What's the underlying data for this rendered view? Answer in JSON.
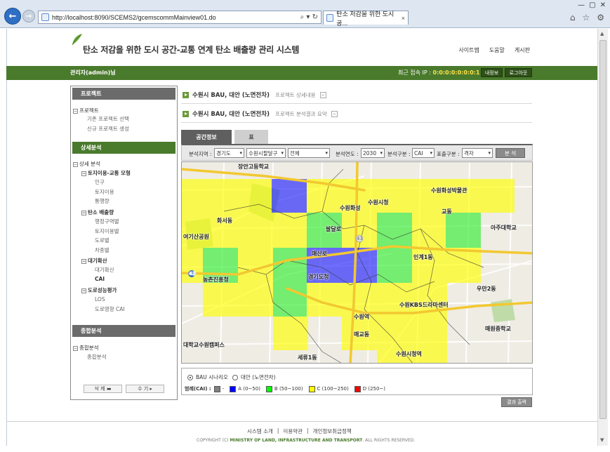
{
  "browser": {
    "url": "http://localhost:8090/SCEMS2/gcemscommMainview01.do",
    "tab_title": "탄소 저감을 위한 도시 공...",
    "tab_close": "×",
    "address_controls": "⌕ ▾ ↻"
  },
  "header": {
    "site_title": "탄소 저감을 위한 도시 공간-교통 연계 탄소 배출량 관리 시스템",
    "links": [
      "사이트맵",
      "도움말",
      "게시판"
    ]
  },
  "userbar": {
    "user": "관리자(admin)님",
    "ip_label": "최근 접속 IP :",
    "ip_value": "0:0:0:0:0:0:0:1",
    "buttons": [
      "내정보",
      "로그아웃"
    ]
  },
  "sidebar": {
    "project_head": "프로젝트",
    "project_items": [
      "프로젝트",
      "기존 프로젝트 선택",
      "신규 프로젝트 생성"
    ],
    "detail_head": "상세분석",
    "detail_items": [
      "상세 분석",
      "토지이용-교통 모형",
      "인구",
      "토지이용",
      "통행량",
      "탄소 배출량",
      "행정구역별",
      "토지이용별",
      "도로별",
      "차종별",
      "대기확산",
      "대기확산",
      "CAI",
      "도로성능평가",
      "LOS",
      "도로영향 CAI"
    ],
    "summary_head": "종합분석",
    "summary_items": [
      "종합분석",
      "종합분석"
    ],
    "btn_delete": "삭 제 ▬",
    "btn_edit": "수 기 ▸"
  },
  "content": {
    "project1_title": "수원시 BAU, 대안 (노면전차)",
    "project1_desc": "프로젝트 상세내용",
    "project2_title": "수원시 BAU, 대안 (노면전차)",
    "project2_desc": "프로젝트 분석결과 요약",
    "tab_spatial": "공간정보",
    "tab_table": "표",
    "filter": {
      "region_label": "분석지역 :",
      "region1": "경기도",
      "region2": "수원시팔달구",
      "region3": "전체",
      "year_label": "분석연도 :",
      "year": "2030",
      "type_label": "분석구분 :",
      "type": "CAI",
      "display_label": "표출구분 :",
      "display": "격자",
      "analyze_btn": "분 석"
    },
    "map_labels": [
      "장안고등학교",
      "수원화성",
      "수원화성박물관",
      "수원시청",
      "아주대학교",
      "교동",
      "우만2동",
      "경기도청",
      "매산로",
      "수원역",
      "매원중학교",
      "세류1동",
      "대학교수원캠퍼스",
      "농촌진흥청",
      "여기산공원",
      "팔달로",
      "인계1동",
      "화서동",
      "매교동",
      "수원KBS드라마센터",
      "수원시청역"
    ],
    "map_small_labels": [
      "42",
      "43"
    ],
    "scenario_bau": "BAU 시나리오",
    "scenario_alt": "대안 (노면전차)",
    "legend_title": "범례(CAI) :",
    "legend": [
      {
        "label": "-",
        "color": "#808080"
      },
      {
        "label": "A (0~50)",
        "color": "#0000ff"
      },
      {
        "label": "B (50~100)",
        "color": "#00ff00"
      },
      {
        "label": "C (100~250)",
        "color": "#ffff00"
      },
      {
        "label": "D (250~)",
        "color": "#ff0000"
      }
    ],
    "export_btn": "결과 출력"
  },
  "footer": {
    "links": [
      "시스템 소개",
      "|",
      "이용약관",
      "|",
      "개인정보취급정책"
    ],
    "copyright_prefix": "COPYRIGHT (C)",
    "copyright_org": "MINISTRY OF LAND, INFRASTRUCTURE AND TRANSPORT",
    "copyright_suffix": ". ALL RIGHTS RESERVED."
  }
}
